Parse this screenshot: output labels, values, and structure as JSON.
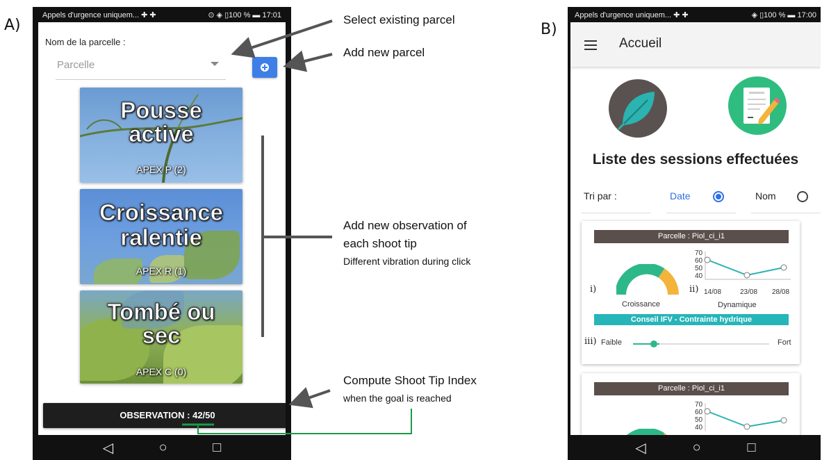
{
  "panels": {
    "a_label": "A)",
    "b_label": "B)"
  },
  "phone_a": {
    "status_left": "Appels d'urgence uniquem... ✚ ✚",
    "status_right": "⊙ ◈ ▯100 % ▬ 17:01",
    "field_label": "Nom de la parcelle :",
    "select_placeholder": "Parcelle",
    "cards": [
      {
        "title_line1": "Pousse",
        "title_line2": "active",
        "sub": "APEX P (2)"
      },
      {
        "title_line1": "Croissance",
        "title_line2": "ralentie",
        "sub": "APEX R (1)"
      },
      {
        "title_line1": "Tombé ou",
        "title_line2": "sec",
        "sub": "APEX C (0)"
      }
    ],
    "observation_button": "OBSERVATION : 42/50",
    "nav": {
      "back": "◁",
      "home": "○",
      "recent": "□"
    }
  },
  "annotations": {
    "select_existing": "Select existing parcel",
    "add_new": "Add new parcel",
    "add_obs_line1": "Add new observation of",
    "add_obs_line2": "each shoot tip",
    "add_obs_line3": "Different vibration during click",
    "compute_line1": "Compute Shoot Tip Index",
    "compute_line2": "when the goal is reached"
  },
  "phone_b": {
    "status_left": "Appels d'urgence uniquem... ✚ ✚",
    "status_right": "◈ ▯100 % ▬ 17:00",
    "app_title": "Accueil",
    "list_title": "Liste des sessions effectuées",
    "sort_label": "Tri par :",
    "sort_options": [
      {
        "label": "Date",
        "selected": true
      },
      {
        "label": "Nom",
        "selected": false
      }
    ],
    "sessions": [
      {
        "parcel": "Parcelle : Piol_ci_i1",
        "marker_i": "i)",
        "marker_ii": "ii)",
        "marker_iii": "iii)",
        "gauge_label": "Croissance",
        "dyn_label": "Dynamique",
        "y_ticks": [
          "70",
          "60",
          "50",
          "40"
        ],
        "x_ticks": [
          "14/08",
          "23/08",
          "28/08"
        ],
        "advice": "Conseil IFV - Contrainte hydrique",
        "slider_low": "Faible",
        "slider_high": "Fort"
      },
      {
        "parcel": "Parcelle : Piol_ci_i1",
        "y_ticks": [
          "70",
          "60",
          "50",
          "40"
        ]
      }
    ],
    "nav": {
      "back": "◁",
      "home": "○",
      "recent": "□"
    }
  },
  "colors": {
    "accent_blue": "#3d7fe6",
    "teal": "#26b5b9",
    "green": "#2ebd7e",
    "gauge_green": "#2db88a",
    "gauge_orange": "#f4b33a"
  }
}
